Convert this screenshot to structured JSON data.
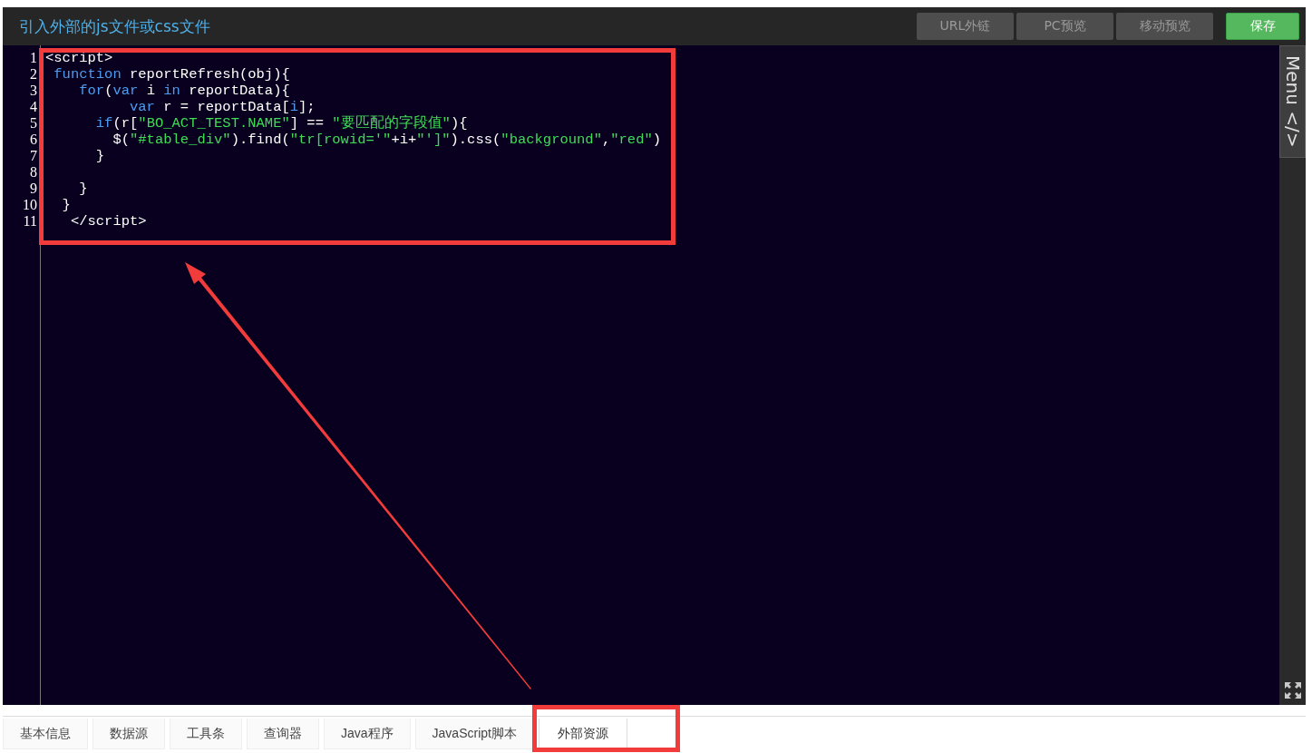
{
  "header": {
    "title": "引入外部的js文件或css文件",
    "buttons": [
      {
        "label": "URL外链",
        "kind": "secondary"
      },
      {
        "label": "PC预览",
        "kind": "secondary"
      },
      {
        "label": "移动预览",
        "kind": "secondary"
      },
      {
        "label": "保存",
        "kind": "primary"
      }
    ]
  },
  "editor": {
    "lines": [
      {
        "number": "1",
        "tokens": [
          {
            "text": "<script>",
            "kind": "plain"
          }
        ]
      },
      {
        "number": "2",
        "tokens": [
          {
            "text": " function",
            "kind": "keyword"
          },
          {
            "text": " reportRefresh(obj){",
            "kind": "plain"
          }
        ]
      },
      {
        "number": "3",
        "tokens": [
          {
            "text": "    for",
            "kind": "keyword"
          },
          {
            "text": "(",
            "kind": "plain"
          },
          {
            "text": "var",
            "kind": "keyword"
          },
          {
            "text": " i ",
            "kind": "plain"
          },
          {
            "text": "in",
            "kind": "keyword"
          },
          {
            "text": " reportData){",
            "kind": "plain"
          }
        ]
      },
      {
        "number": "4",
        "tokens": [
          {
            "text": "          var",
            "kind": "keyword"
          },
          {
            "text": " r = reportData[",
            "kind": "plain"
          },
          {
            "text": "i",
            "kind": "keyword"
          },
          {
            "text": "];",
            "kind": "plain"
          }
        ]
      },
      {
        "number": "5",
        "tokens": [
          {
            "text": "      if",
            "kind": "keyword"
          },
          {
            "text": "(r[",
            "kind": "plain"
          },
          {
            "text": "\"BO_ACT_TEST.NAME\"",
            "kind": "string"
          },
          {
            "text": "] == ",
            "kind": "plain"
          },
          {
            "text": "\"要匹配的字段值\"",
            "kind": "string"
          },
          {
            "text": "){",
            "kind": "plain"
          }
        ]
      },
      {
        "number": "6",
        "tokens": [
          {
            "text": "        $(",
            "kind": "plain"
          },
          {
            "text": "\"#table_div\"",
            "kind": "string"
          },
          {
            "text": ").find(",
            "kind": "plain"
          },
          {
            "text": "\"tr[rowid='\"",
            "kind": "string"
          },
          {
            "text": "+i+",
            "kind": "plain"
          },
          {
            "text": "\"']\"",
            "kind": "string"
          },
          {
            "text": ").css(",
            "kind": "plain"
          },
          {
            "text": "\"background\"",
            "kind": "string"
          },
          {
            "text": ",",
            "kind": "plain"
          },
          {
            "text": "\"red\"",
            "kind": "string"
          },
          {
            "text": ")",
            "kind": "plain"
          }
        ]
      },
      {
        "number": "7",
        "tokens": [
          {
            "text": "      }",
            "kind": "plain"
          }
        ]
      },
      {
        "number": "8"
      },
      {
        "number": "9",
        "tokens": [
          {
            "text": "    }",
            "kind": "plain"
          }
        ]
      },
      {
        "number": "10",
        "tokens": [
          {
            "text": "  }",
            "kind": "plain"
          }
        ]
      },
      {
        "number": "11",
        "tokens": [
          {
            "text": "   </script>",
            "kind": "plain"
          }
        ]
      }
    ]
  },
  "side_menu": {
    "label": "Menu </>"
  },
  "tabs": [
    {
      "label": "基本信息",
      "selected": false
    },
    {
      "label": "数据源",
      "selected": false
    },
    {
      "label": "工具条",
      "selected": false
    },
    {
      "label": "查询器",
      "selected": false
    },
    {
      "label": "Java程序",
      "selected": false
    },
    {
      "label": "JavaScript脚本",
      "selected": false
    },
    {
      "label": "外部资源",
      "selected": true
    }
  ]
}
